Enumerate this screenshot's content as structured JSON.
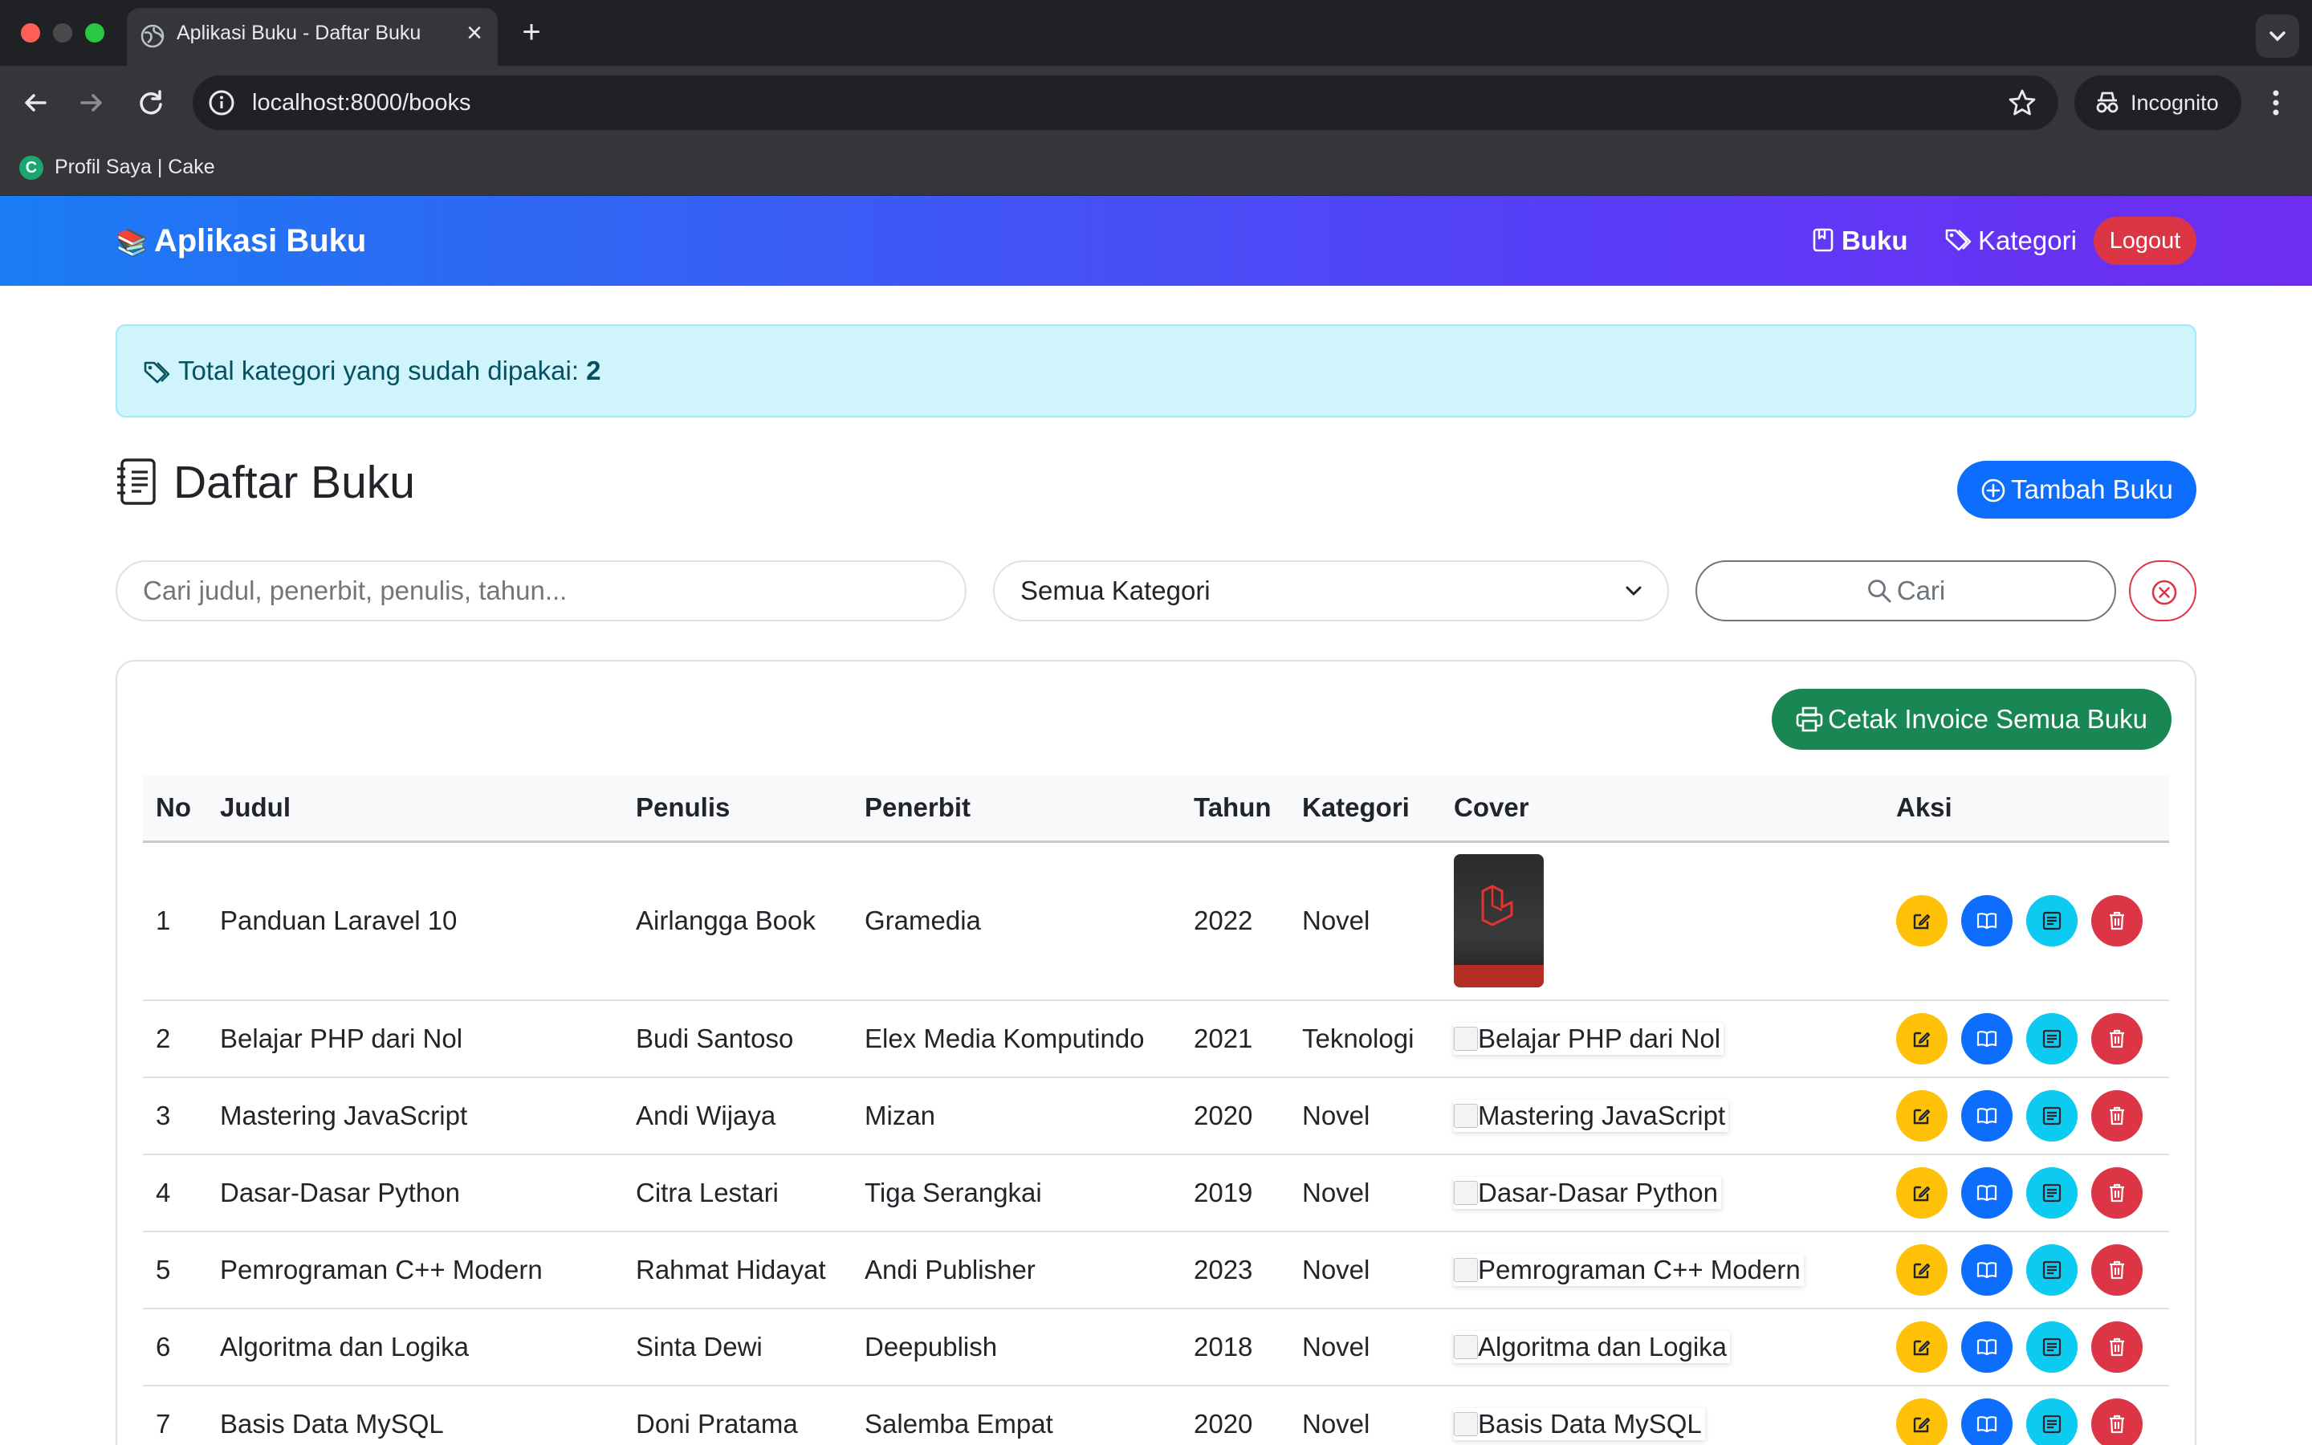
{
  "browser": {
    "tab_title": "Aplikasi Buku - Daftar Buku",
    "url": "localhost:8000/books",
    "incognito_label": "Incognito",
    "bookmark": {
      "label": "Profil Saya | Cake",
      "favicon_letter": "C"
    }
  },
  "navbar": {
    "brand_emoji": "📚",
    "brand": "Aplikasi Buku",
    "links": [
      "Buku",
      "Kategori"
    ],
    "logout": "Logout",
    "gradient": [
      "#1a7cf3",
      "#6e2df0"
    ]
  },
  "alert": {
    "text": "Total kategori yang sudah dipakai:",
    "count": "2"
  },
  "page": {
    "title": "Daftar Buku",
    "add_button": "Tambah Buku"
  },
  "filters": {
    "search_placeholder": "Cari judul, penerbit, penulis, tahun...",
    "category_value": "Semua Kategori",
    "search_button": "Cari"
  },
  "invoice_button": "Cetak Invoice Semua Buku",
  "table": {
    "headers": [
      "No",
      "Judul",
      "Penulis",
      "Penerbit",
      "Tahun",
      "Kategori",
      "Cover",
      "Aksi"
    ],
    "rows": [
      {
        "no": "1",
        "judul": "Panduan Laravel 10",
        "penulis": "Airlangga Book",
        "penerbit": "Gramedia",
        "tahun": "2022",
        "kategori": "Novel",
        "cover_alt": ""
      },
      {
        "no": "2",
        "judul": "Belajar PHP dari Nol",
        "penulis": "Budi Santoso",
        "penerbit": "Elex Media Komputindo",
        "tahun": "2021",
        "kategori": "Teknologi",
        "cover_alt": "Belajar PHP dari Nol"
      },
      {
        "no": "3",
        "judul": "Mastering JavaScript",
        "penulis": "Andi Wijaya",
        "penerbit": "Mizan",
        "tahun": "2020",
        "kategori": "Novel",
        "cover_alt": "Mastering JavaScript"
      },
      {
        "no": "4",
        "judul": "Dasar-Dasar Python",
        "penulis": "Citra Lestari",
        "penerbit": "Tiga Serangkai",
        "tahun": "2019",
        "kategori": "Novel",
        "cover_alt": "Dasar-Dasar Python"
      },
      {
        "no": "5",
        "judul": "Pemrograman C++ Modern",
        "penulis": "Rahmat Hidayat",
        "penerbit": "Andi Publisher",
        "tahun": "2023",
        "kategori": "Novel",
        "cover_alt": "Pemrograman C++ Modern"
      },
      {
        "no": "6",
        "judul": "Algoritma dan Logika",
        "penulis": "Sinta Dewi",
        "penerbit": "Deepublish",
        "tahun": "2018",
        "kategori": "Novel",
        "cover_alt": "Algoritma dan Logika"
      },
      {
        "no": "7",
        "judul": "Basis Data MySQL",
        "penulis": "Doni Pratama",
        "penerbit": "Salemba Empat",
        "tahun": "2020",
        "kategori": "Novel",
        "cover_alt": "Basis Data MySQL"
      }
    ]
  },
  "action_icons": [
    "edit-icon",
    "book-open-icon",
    "journal-icon",
    "trash-icon"
  ],
  "colors": {
    "primary": "#0d6efd",
    "success": "#198754",
    "warning": "#ffc107",
    "info": "#0dcaf0",
    "danger": "#dc3545",
    "alert_bg": "#cff4fc"
  }
}
